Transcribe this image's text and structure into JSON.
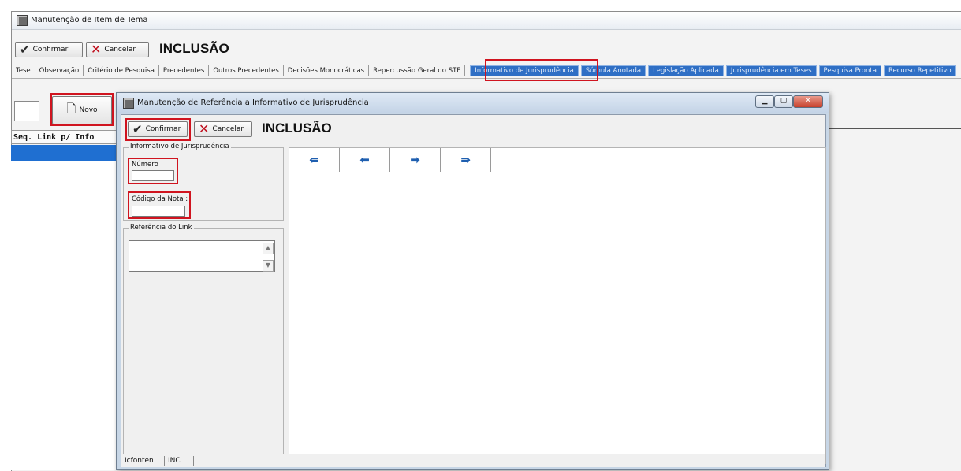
{
  "main_window": {
    "title": "Manutenção de Item de Tema",
    "toolbar": {
      "confirm_label": "Confirmar",
      "cancel_label": "Cancelar",
      "mode_label": "INCLUSÃO"
    },
    "tabs": [
      {
        "label": "Tese"
      },
      {
        "label": "Observação"
      },
      {
        "label": "Critério de Pesquisa"
      },
      {
        "label": "Precedentes"
      },
      {
        "label": "Outros Precedentes"
      },
      {
        "label": "Decisões Monocráticas"
      },
      {
        "label": "Repercussão Geral do STF"
      },
      {
        "label": "Informativo de Jurisprudência"
      },
      {
        "label": "Súmula Anotada"
      },
      {
        "label": "Legislação Aplicada"
      },
      {
        "label": "Jurisprudência em Teses"
      },
      {
        "label": "Pesquisa Pronta"
      },
      {
        "label": "Recurso Repetitivo"
      }
    ],
    "new_button_label": "Novo",
    "list_header": "Seq. Link p/ Info"
  },
  "dialog": {
    "title": "Manutenção de Referência a Informativo de Jurisprudência",
    "toolbar": {
      "confirm_label": "Confirmar",
      "cancel_label": "Cancelar",
      "mode_label": "INCLUSÃO"
    },
    "informativo_group": {
      "legend": "Informativo de Jurisprudência",
      "numero_label": "Número",
      "numero_value": "",
      "codigo_label": "Código da Nota :",
      "codigo_value": ""
    },
    "referencia_group": {
      "legend": "Referência do Link",
      "value": ""
    },
    "nav_buttons": [
      {
        "name": "first-record-button",
        "icon": "double-arrow-left-icon",
        "glyph": "⇚"
      },
      {
        "name": "previous-record-button",
        "icon": "arrow-left-icon",
        "glyph": "⬅"
      },
      {
        "name": "next-record-button",
        "icon": "arrow-right-icon",
        "glyph": "➡"
      },
      {
        "name": "last-record-button",
        "icon": "double-arrow-right-icon",
        "glyph": "⇛"
      }
    ],
    "status_bar": {
      "cell1": "Icfonten",
      "cell2": "INC"
    }
  },
  "colors": {
    "highlight_red": "#d0141f",
    "tab_blue": "#2f6fc5",
    "selection_blue": "#1f6fd1"
  }
}
